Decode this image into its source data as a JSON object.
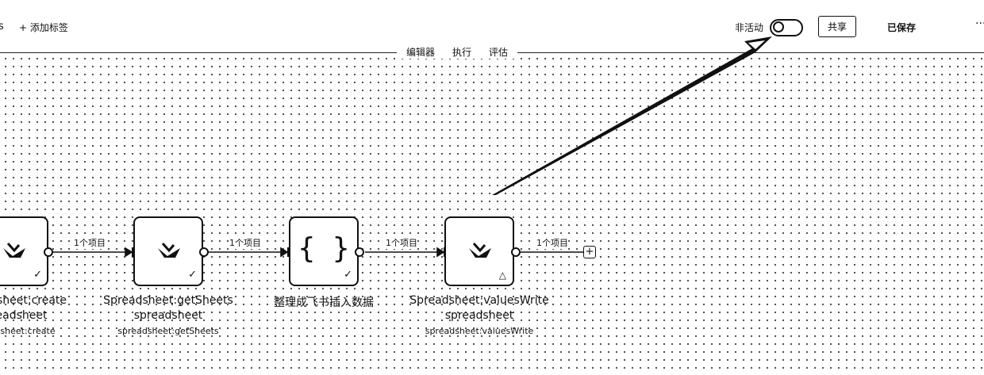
{
  "header": {
    "title_fragment": "s",
    "add_tag": "+ 添加标签",
    "tabs": [
      "编辑器",
      "执行",
      "评估"
    ],
    "status_label": "非活动",
    "toggle_active": false,
    "share": "共享",
    "saved": "已保存",
    "more": "···"
  },
  "nodes": [
    {
      "title": "sheet:create",
      "subtitle": "eadsheet",
      "op": "sheet:create",
      "state": "check"
    },
    {
      "title": "Spreadsheet:getSheets",
      "subtitle": "spreadsheet",
      "op": "spreadsheet:getSheets",
      "state": "check"
    },
    {
      "title": "整理成飞书插入数据",
      "subtitle": "",
      "op": "",
      "state": "check",
      "icon": "{ }"
    },
    {
      "title": "Spreadsheet:valuesWrite",
      "subtitle": "spreadsheet",
      "op": "spreadsheet:valuesWrite",
      "state": "warning"
    }
  ],
  "edges": [
    "1个项目",
    "1个项目",
    "1个项目",
    "1个项目"
  ],
  "icons": {
    "check": "✓",
    "warning": "△",
    "add": "+"
  },
  "colors": {
    "line": "#111111",
    "background": "#ffffff",
    "dots": "#4a4a4a"
  }
}
